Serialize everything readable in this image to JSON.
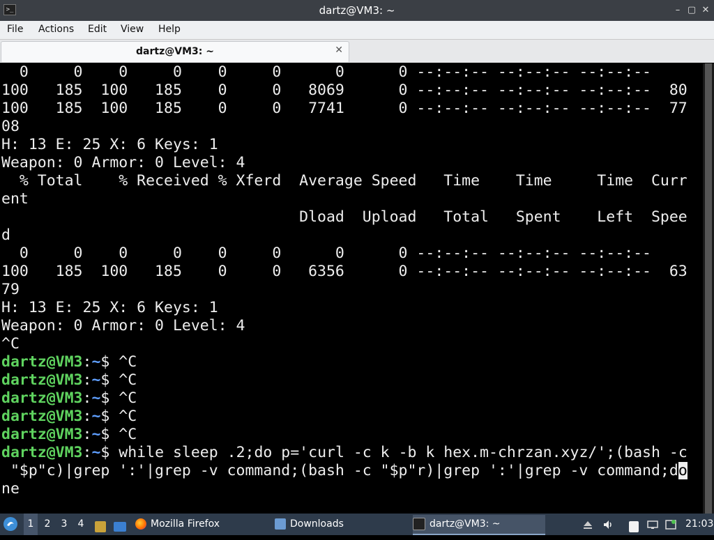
{
  "window": {
    "title": "dartz@VM3: ~",
    "app_icon_glyph": ">_",
    "controls": {
      "minimize": "–",
      "maximize": "▢",
      "close": "✕"
    }
  },
  "menubar": {
    "items": [
      "File",
      "Actions",
      "Edit",
      "View",
      "Help"
    ]
  },
  "tabs": [
    {
      "label": "dartz@VM3: ~",
      "close": "✕"
    }
  ],
  "terminal": {
    "plain_lines": [
      "  0     0    0     0    0     0      0      0 --:--:-- --:--:-- --:--:--",
      "100   185  100   185    0     0   8069      0 --:--:-- --:--:-- --:--:--  80",
      "100   185  100   185    0     0   7741      0 --:--:-- --:--:-- --:--:--  77",
      "08",
      "H: 13 E: 25 X: 6 Keys: 1",
      "Weapon: 0 Armor: 0 Level: 4",
      "  % Total    % Received % Xferd  Average Speed   Time    Time     Time  Curr",
      "ent",
      "                                 Dload  Upload   Total   Spent    Left  Spee",
      "d",
      "  0     0    0     0    0     0      0      0 --:--:-- --:--:-- --:--:--",
      "100   185  100   185    0     0   6356      0 --:--:-- --:--:-- --:--:--  63",
      "79",
      "H: 13 E: 25 X: 6 Keys: 1",
      "Weapon: 0 Armor: 0 Level: 4",
      "^C"
    ],
    "prompt_user": "dartz@VM3",
    "prompt_sep": ":",
    "prompt_path": "~",
    "prompt_dollar": "$ ",
    "prompt_commands": [
      "^C",
      "^C",
      "^C",
      "^C",
      "^C"
    ],
    "final_command_prefix": "while sleep .2;do p='curl -c k -b k hex.m-chrzan.xyz/';(bash -c",
    "wrap_line_before_cursor": " \"$p\"c)|grep ':'|grep -v command;(bash -c \"$p\"r)|grep ':'|grep -v command;d",
    "cursor_char": "o",
    "wrap_line_after": "ne"
  },
  "taskbar": {
    "workspaces": [
      "1",
      "2",
      "3",
      "4"
    ],
    "active_workspace": "1",
    "tasks": [
      {
        "label": "Mozilla Firefox",
        "icon": "firefox-icon"
      },
      {
        "label": "Downloads",
        "icon": "folder-icon"
      },
      {
        "label": "dartz@VM3: ~",
        "icon": "terminal-icon",
        "active": true
      }
    ],
    "clock": "21:03"
  },
  "colors": {
    "prompt_user": "#5fd35f",
    "prompt_path": "#5f9fff",
    "terminal_bg": "#000000",
    "taskbar_bg": "#2e3b4b"
  }
}
